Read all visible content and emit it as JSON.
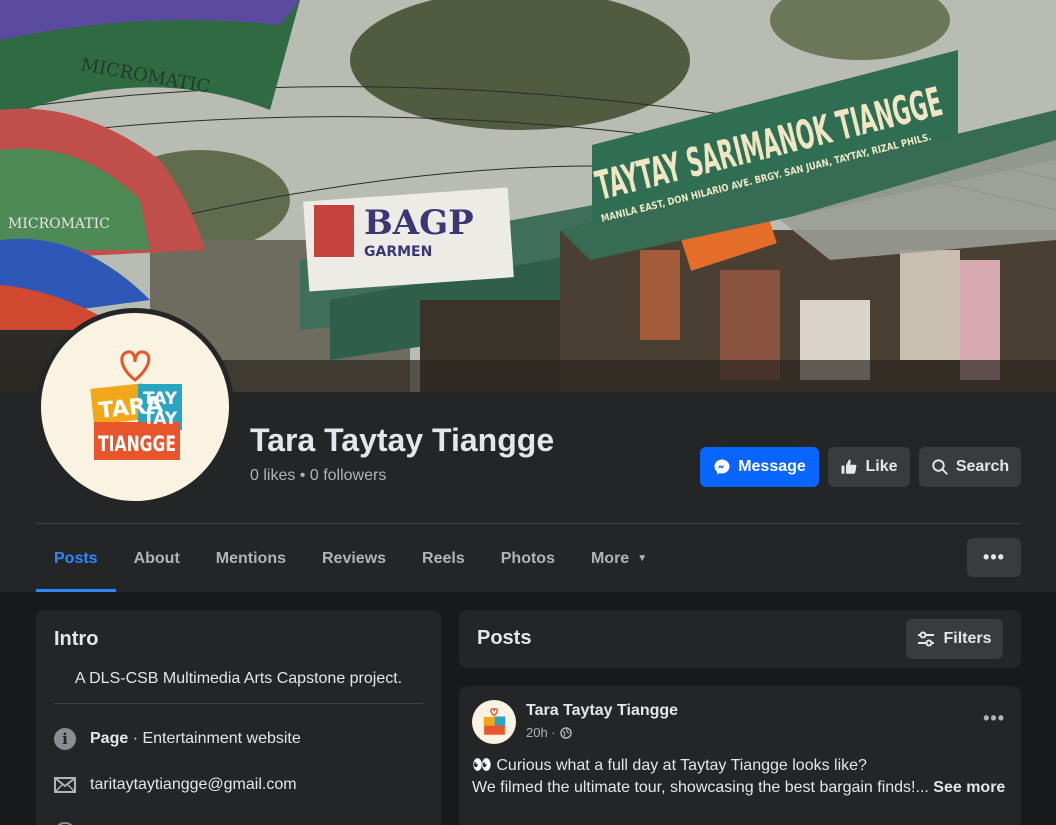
{
  "page": {
    "name": "Tara Taytay Tiangge",
    "stats": "0 likes • 0 followers",
    "logo_text": [
      "TARA",
      "TAY",
      "TAY",
      "TIANGGE"
    ]
  },
  "cover": {
    "sign_main": "TAYTAY SARIMANOK TIANGGE",
    "sign_sub": "MANILA EAST, DON HILARIO AVE.   BRGY. SAN JUAN, TAYTAY, RIZAL PHILS.",
    "sign_left": "BAGP",
    "sign_left_sub": "GARMEN",
    "umbrella_text": "MICROMATIC"
  },
  "actions": {
    "message": "Message",
    "like": "Like",
    "search": "Search"
  },
  "tabs": [
    {
      "label": "Posts"
    },
    {
      "label": "About"
    },
    {
      "label": "Mentions"
    },
    {
      "label": "Reviews"
    },
    {
      "label": "Reels"
    },
    {
      "label": "Photos"
    },
    {
      "label": "More"
    }
  ],
  "more_dots": "•••",
  "intro": {
    "title": "Intro",
    "bio": "A DLS-CSB Multimedia Arts Capstone project.",
    "page_label": "Page",
    "page_category": " · Entertainment website",
    "email": "taritaytaytiangge@gmail.com"
  },
  "posts": {
    "title": "Posts",
    "filters": "Filters"
  },
  "post": {
    "author": "Tara Taytay Tiangge",
    "time": "20h ·",
    "emoji": "👀",
    "line1": " Curious what a full day at Taytay Tiangge looks like?",
    "line2": "We filmed the ultimate tour, showcasing the best bargain finds!... ",
    "see_more": "See more",
    "dots": "•••"
  },
  "colors": {
    "accent": "#2d88ff",
    "message_button": "#0866ff",
    "card": "#242526",
    "background": "#18191a"
  }
}
